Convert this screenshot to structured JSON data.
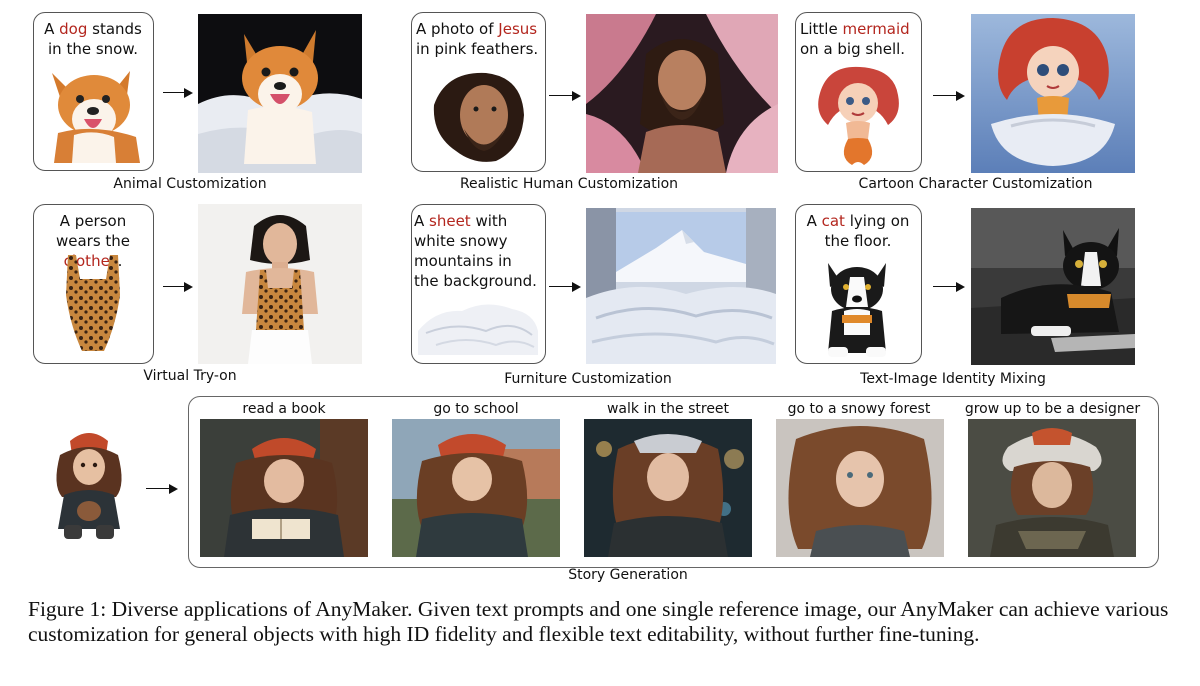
{
  "panels": {
    "animal": {
      "prompt_pre": "A ",
      "prompt_hl": "dog",
      "prompt_post": " stands in the snow.",
      "label": "Animal Customization"
    },
    "human": {
      "prompt_pre": "A photo of ",
      "prompt_hl": "Jesus",
      "prompt_post": " in pink feathers.",
      "label": "Realistic Human Customization"
    },
    "cartoon": {
      "prompt_pre": "Little ",
      "prompt_hl": "mermaid",
      "prompt_post": " on a big shell.",
      "label": "Cartoon Character Customization"
    },
    "tryon": {
      "prompt_pre": "A person wears the ",
      "prompt_hl": "clothes",
      "prompt_post": ".",
      "label": "Virtual Try-on"
    },
    "furniture": {
      "prompt_pre": "A ",
      "prompt_hl": "sheet",
      "prompt_post": " with white snowy mountains in the background.",
      "label": "Furniture Customization"
    },
    "mixing": {
      "prompt_pre": "A ",
      "prompt_hl": "cat",
      "prompt_post": " lying on the floor.",
      "label": "Text-Image Identity Mixing"
    }
  },
  "story": {
    "label": "Story Generation",
    "prompts": [
      "read a book",
      "go to school",
      "walk in the street",
      "go to a snowy forest",
      "grow up to be a designer"
    ]
  },
  "colors": {
    "highlight": "#b3261e"
  },
  "caption": "Figure 1: Diverse applications of AnyMaker. Given text prompts and one single reference image, our AnyMaker can achieve various customization for general objects with high ID fidelity and flexible text editability, without further fine-tuning."
}
